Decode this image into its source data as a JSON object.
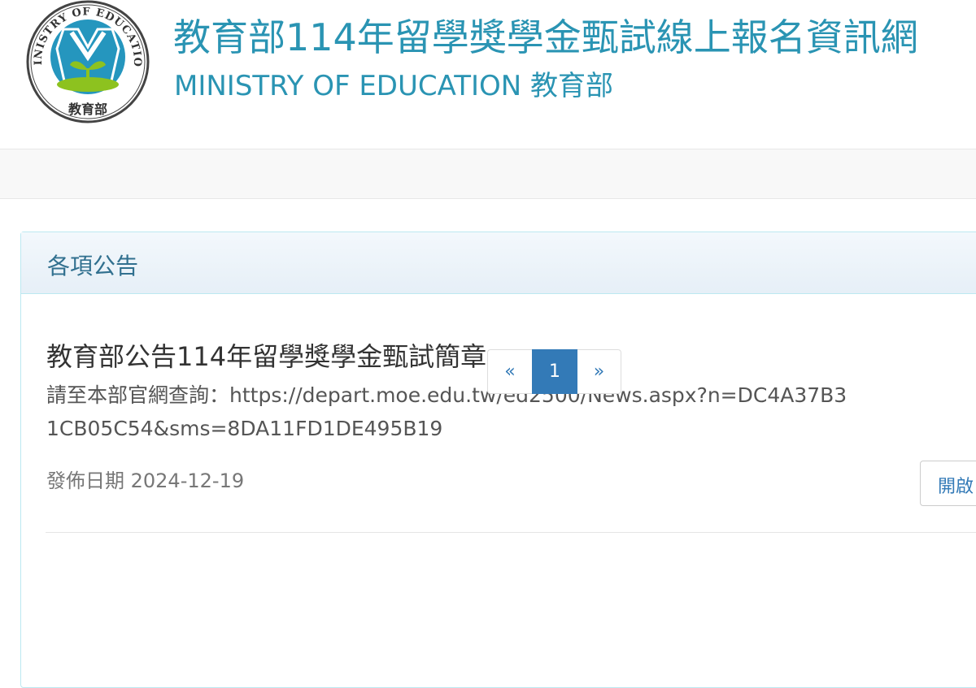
{
  "header": {
    "logo_text_top": "MINISTRY OF EDUCATION",
    "logo_text_bottom": "教育部",
    "title": "教育部114年留學獎學金甄試線上報名資訊網",
    "subtitle": "MINISTRY OF EDUCATION 教育部"
  },
  "panel": {
    "heading": "各項公告",
    "news": {
      "title": "教育部公告114年留學獎學金甄試簡章",
      "body": "請至本部官網查詢：https://depart.moe.edu.tw/ed2500/News.aspx?n=DC4A37B31CB05C54&sms=8DA11FD1DE495B19",
      "date": "發佈日期 2024-12-19",
      "open_label": "開啟"
    }
  },
  "pagination": {
    "prev": "«",
    "current": "1",
    "next": "»"
  },
  "colors": {
    "brand": "#2a94b3",
    "link": "#337ab7",
    "panel_heading_text": "#31708f",
    "logo_leaf": "#8dc21f",
    "logo_bg": "#2596be"
  }
}
